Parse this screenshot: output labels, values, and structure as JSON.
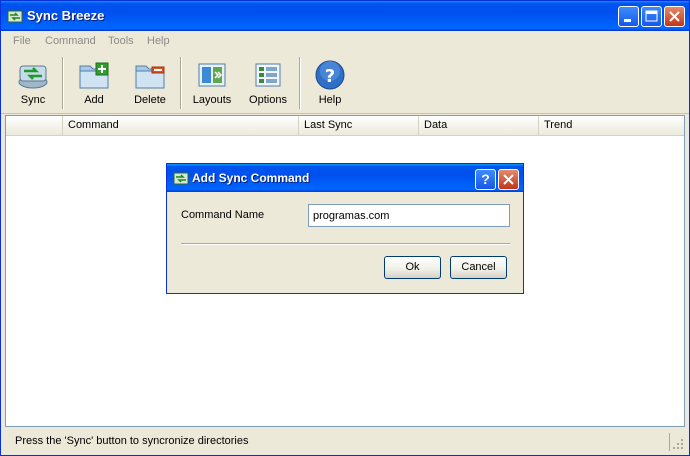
{
  "window": {
    "title": "Sync Breeze"
  },
  "menu": [
    "File",
    "Command",
    "Tools",
    "Help"
  ],
  "toolbar": {
    "sync": "Sync",
    "add": "Add",
    "delete": "Delete",
    "layouts": "Layouts",
    "options": "Options",
    "help": "Help"
  },
  "list": {
    "columns": [
      "Command",
      "Last Sync",
      "Data",
      "Trend"
    ]
  },
  "status": {
    "text": "Press the 'Sync' button to syncronize directories"
  },
  "dialog": {
    "title": "Add Sync Command",
    "help_glyph": "?",
    "label": "Command Name",
    "input_value": "programas.com",
    "ok": "Ok",
    "cancel": "Cancel"
  },
  "colors": {
    "titlebar": "#0053ee",
    "window_bg": "#ece9d8",
    "close": "#c2351a"
  },
  "icons": [
    "app-icon",
    "minimize-icon",
    "maximize-icon",
    "close-icon",
    "sync-icon",
    "add-folder-icon",
    "delete-folder-icon",
    "layouts-icon",
    "options-icon",
    "help-icon",
    "size-grip-icon"
  ]
}
